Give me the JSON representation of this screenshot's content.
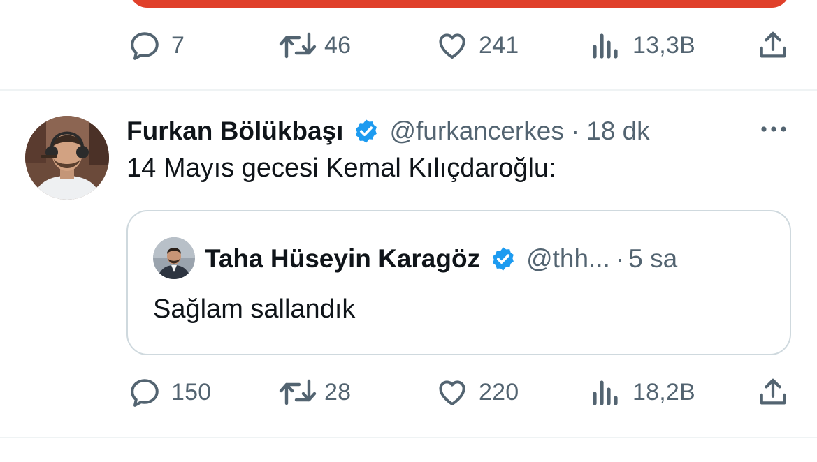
{
  "top_actions": {
    "replies": "7",
    "reposts": "46",
    "likes": "241",
    "views": "13,3B"
  },
  "tweet": {
    "author_name": "Furkan Bölükbaşı",
    "handle": "@furkancerkes",
    "separator": "·",
    "time": "18 dk",
    "text": "14 Mayıs gecesi Kemal Kılıçdaroğlu:",
    "quote": {
      "author_name": "Taha Hüseyin Karagöz",
      "handle": "@thh...",
      "separator": "·",
      "time": "5 sa",
      "text": "Sağlam sallandık"
    },
    "actions": {
      "replies": "150",
      "reposts": "28",
      "likes": "220",
      "views": "18,2B"
    }
  },
  "colors": {
    "verified": "#1d9bf0",
    "secondary_text": "#536471",
    "banner": "#e0402a",
    "border": "#cfd9de"
  },
  "icons": [
    "reply-icon",
    "repost-icon",
    "like-icon",
    "views-icon",
    "share-icon",
    "verified-icon",
    "more-icon"
  ]
}
